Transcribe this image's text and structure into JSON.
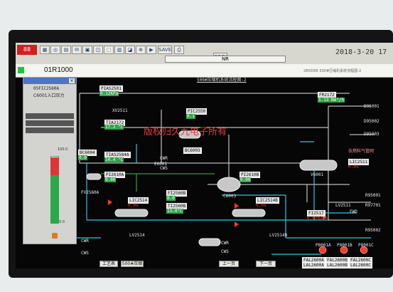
{
  "toolbar": {
    "date": "2018-3-20 17",
    "mode": "NR",
    "copy_label": "COPY",
    "save_label": "SAVE"
  },
  "tagbar": {
    "tag": "01R1000",
    "right_text": "28000IR 500#压缩机系统流程图-2"
  },
  "diagram": {
    "title": "500#压缩机系统流程图-2",
    "watermark": "版权归久九电子所有"
  },
  "faceplate": {
    "tag": "05FIC2560A",
    "desc": "C6001入口压力",
    "scale_top": "100.0",
    "scale_bottom": "0.0"
  },
  "instruments": {
    "pias2501": {
      "tag": "PIAS2501",
      "value": "0.12KPa"
    },
    "xv2511": {
      "tag": "XV2511"
    },
    "tia2172": {
      "tag": "TIA2172",
      "value": "17.2 °C"
    },
    "pic2550": {
      "tag": "PIC2550",
      "value": "0.1"
    },
    "fr2172": {
      "tag": "FR2172",
      "value": "1.13 Nm³/h"
    },
    "bc6003": {
      "tag": "BC6003"
    },
    "bc6004": {
      "tag": "BC6004",
      "value": "0.0"
    },
    "tias2584a": {
      "tag": "TIAS2584A",
      "value": "14.4 °C"
    },
    "pi2610a": {
      "tag": "PI2610A",
      "value": "0.00"
    },
    "lic2514": {
      "tag": "LIC2514",
      "value": "0.0%"
    },
    "fi2560b": {
      "tag": "FI2560B",
      "value": "0.0"
    },
    "ti2560b": {
      "tag": "TI2560B",
      "value": "13.0°C"
    },
    "pi2610b": {
      "tag": "PI2610B",
      "value": "0.00"
    },
    "lic2514b": {
      "tag": "LIC2514B",
      "value": "0.0%"
    },
    "lic2511": {
      "tag": "LIC2511",
      "value": "0.0%"
    },
    "fi2517": {
      "tag": "FI2517",
      "value": "0.00m3/h"
    },
    "fal2600a": {
      "tag": "FAL2600A"
    },
    "fal2600b": {
      "tag": "FAL2600B"
    },
    "fal2600c": {
      "tag": "FAL2600C"
    },
    "lal2600a": {
      "tag": "LAL2600A"
    },
    "lal2600b": {
      "tag": "LAL2600B"
    },
    "lal2600c": {
      "tag": "LAL2600C"
    }
  },
  "labels": {
    "cwr": "CWR",
    "cws": "CWS",
    "fwd": "FWD",
    "c6003": "C6003",
    "e6001": "E6001",
    "v6001": "V6001",
    "lv2511": "LV2511",
    "lv2514": "LV2514",
    "lv2514b": "LV2514B",
    "p8001a": "P8001A",
    "p8001b": "P8001B",
    "p8001c": "P8001C",
    "fv2560a": "FV2560A",
    "d95001": "D95001",
    "d95002": "D95002",
    "d95003": "D95003",
    "r95001": "R95001",
    "r95002": "R95002",
    "r97701": "R97701",
    "gas_out": "去燃料气管网"
  },
  "buttons": {
    "b1": "工艺表",
    "b2": "500#压缩",
    "b3": "上一页",
    "b4": "下一页"
  }
}
